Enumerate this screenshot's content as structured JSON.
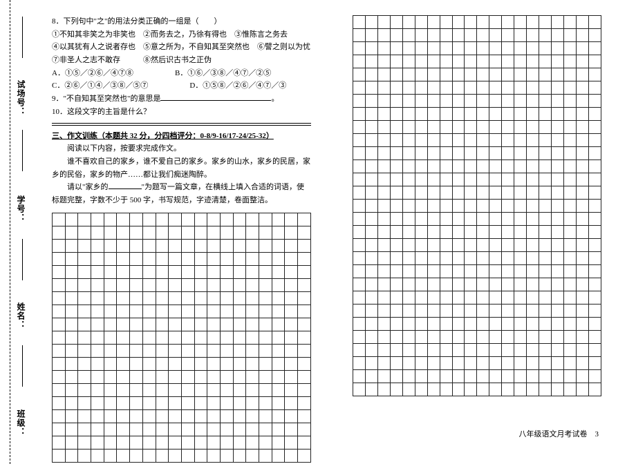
{
  "side": {
    "banji": "班级：",
    "xingming": "姓名：",
    "xuehao": "学号：",
    "shichang": "试场号："
  },
  "q8": {
    "stem": "8．下列句中\"之\"的用法分类正确的一组是（　　）",
    "lines": [
      "①不知其非笑之为非笑也　②而务去之，乃徐有得也　③惟陈言之务去",
      "④以其犹有人之说者存也　⑤意之所为，不自知其至突然也　⑥譬之则以为忧",
      "⑦非圣人之志不敢存　　　⑧然后识古书之正伪"
    ],
    "optA": "A．①⑤／②⑥／④⑦⑧",
    "optB": "B．①⑥／③⑧／④⑦／②⑤",
    "optC": "C．②⑥／①④／③⑧／⑤⑦",
    "optD": "D．①⑤⑧／②⑥／④⑦／③"
  },
  "q9": "9．\"不自知其至突然也\"的意思是",
  "q10": "10．这段文字的主旨是什么？",
  "section3": {
    "head": "三、作文训练（本题共 32 分，分四档评分：0-8/9-16/17-24/25-32）",
    "p1": "阅读以下内容，按要求完成作文。",
    "p2": "谁不喜欢自己的家乡，谁不爱自己的家乡。家乡的山水，家乡的民居，家乡的民俗，家乡的物产……都让我们痴迷陶醉。",
    "p3a": "请以\"家乡的",
    "p3b": "\"为题写一篇文章，在横线上填入合适的词语，使标题完整，字数不少于 500 字，书写规范，字迹清楚，卷面整洁。"
  },
  "footer": "八年级语文月考试卷　3"
}
